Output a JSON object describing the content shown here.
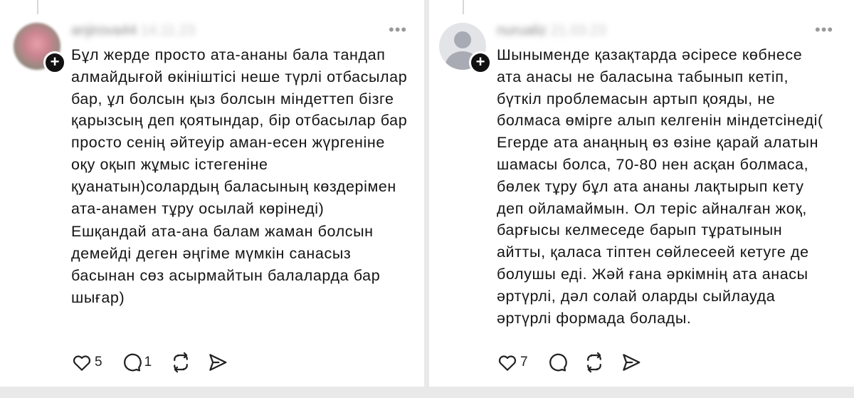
{
  "posts": [
    {
      "username": "anjirova44",
      "timestamp": "14.11.23",
      "avatar": "photo-avatar",
      "paragraphs": [
        "Бұл жерде просто ата-ананы бала тандап алмайдығой өкініштісі неше түрлі отбасылар бар, ұл болсын қыз болсын міндеттеп бізге қарызсың деп қоятындар, бір отбасылар бар просто сенің әйтеуір аман-есен жүргеніне оқу оқып жұмыс істегеніне қуанатын)солардың баласының көздерімен ата-анамен тұру осылай көрінеді)",
        "Ешқандай ата-ана балам жаман болсын демейді деген әңгіме мүмкін санасыз басынан сөз асырмайтын балаларда бар шығар)"
      ],
      "likes": "5",
      "replies": "1",
      "reposts": "",
      "icons": [
        "heart-icon",
        "comment-icon",
        "repost-icon",
        "share-icon"
      ]
    },
    {
      "username": "nurualiz",
      "timestamp": "21.03.23",
      "avatar": "default-avatar",
      "paragraphs": [
        "Шыныменде қазақтарда әсіресе көбнесе ата анасы не баласына табынып кетіп, бүткіл проблемасын артып қояды, не болмаса өмірге алып келгенін міндетсінеді( Егерде ата анаңның өз өзіне қарай алатын шамасы болса, 70-80 нен асқан болмаса, бөлек тұру бұл ата ананы лақтырып кету деп ойламаймын. Ол теріс айналған жоқ, барғысы келмеседе барып тұратынын айтты, қаласа тіптен сөйлесеей кетуге де болушы еді. Жәй ғана әркімнің ата анасы әртүрлі, дәл солай оларды сыйлауда әртүрлі формада болады."
      ],
      "likes": "7",
      "replies": "",
      "reposts": "",
      "icons": [
        "heart-icon",
        "comment-icon",
        "repost-icon",
        "share-icon"
      ]
    }
  ],
  "colors": {
    "background": "#e9e9ea",
    "card": "#ffffff",
    "text": "#141414",
    "muted": "#9a9a9a"
  }
}
